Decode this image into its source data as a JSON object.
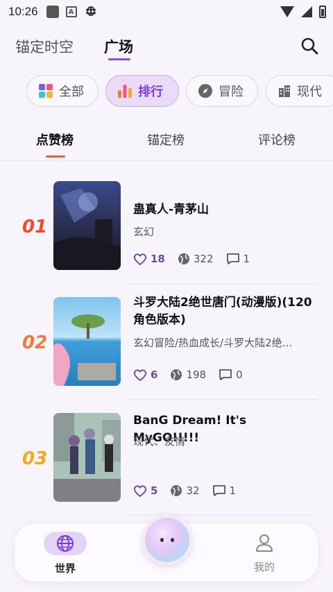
{
  "status_bar": {
    "time": "10:26"
  },
  "top_nav": {
    "tabs": [
      {
        "label": "锚定时空",
        "active": false
      },
      {
        "label": "广场",
        "active": true
      }
    ]
  },
  "categories": [
    {
      "label": "全部",
      "icon": "grid-icon",
      "active": false
    },
    {
      "label": "排行",
      "icon": "bar-chart-icon",
      "active": true
    },
    {
      "label": "冒险",
      "icon": "compass-icon",
      "active": false
    },
    {
      "label": "现代",
      "icon": "building-icon",
      "active": false
    }
  ],
  "sub_tabs": [
    {
      "label": "点赞榜",
      "active": true
    },
    {
      "label": "锚定榜",
      "active": false
    },
    {
      "label": "评论榜",
      "active": false
    }
  ],
  "items": [
    {
      "rank": "01",
      "rank_color": "#ef4a2e",
      "title": "蛊真人-青茅山",
      "tags": "玄幻",
      "likes": "18",
      "views": "322",
      "comments": "1"
    },
    {
      "rank": "02",
      "rank_color": "#f07a3a",
      "title": "斗罗大陆2绝世唐门(动漫版)(120角色版本)",
      "tags": "玄幻冒险/热血成长/斗罗大陆2绝…",
      "likes": "6",
      "views": "198",
      "comments": "0"
    },
    {
      "rank": "03",
      "rank_color": "#f5a623",
      "title": "BanG Dream! It's MyGO!!!!!",
      "tags": "现代、友情",
      "likes": "5",
      "views": "32",
      "comments": "1"
    }
  ],
  "bottom_nav": {
    "world_label": "世界",
    "me_label": "我的"
  },
  "colors": {
    "accent": "#8a4fd6",
    "active_chip_bg": "#eadcf8",
    "subtab_underline": "#f05a3a"
  }
}
